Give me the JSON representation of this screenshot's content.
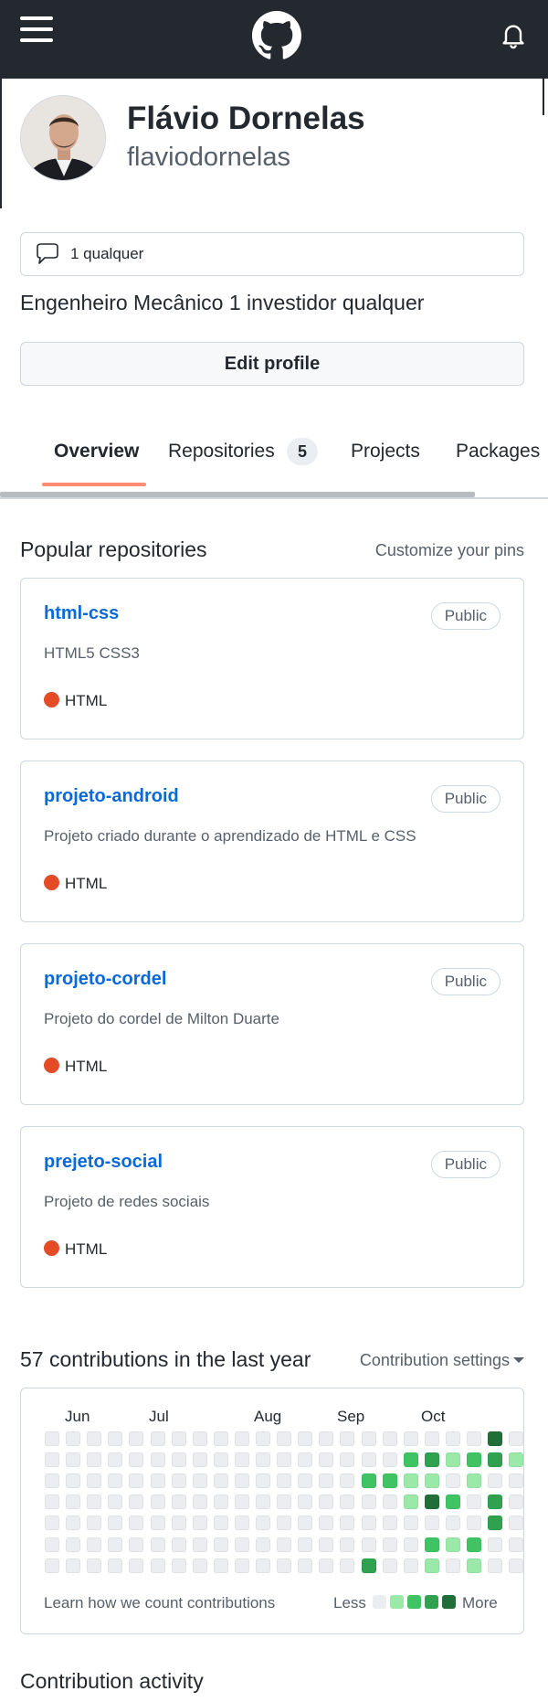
{
  "header": {
    "menu_icon": "hamburger-menu-icon",
    "logo_icon": "github-octocat-icon",
    "notifications_icon": "bell-icon"
  },
  "profile": {
    "name": "Flávio Dornelas",
    "login": "flaviodornelas",
    "status": "1 qualquer",
    "bio": "Engenheiro Mecânico 1 investidor qualquer",
    "edit_label": "Edit profile"
  },
  "tabs": {
    "overview": "Overview",
    "repositories": "Repositories",
    "repositories_count": "5",
    "projects": "Projects",
    "packages": "Packages"
  },
  "popular": {
    "title": "Popular repositories",
    "customize": "Customize your pins",
    "repos": [
      {
        "name": "html-css",
        "visibility": "Public",
        "description": "HTML5 CSS3",
        "language": "HTML"
      },
      {
        "name": "projeto-android",
        "visibility": "Public",
        "description": "Projeto criado durante o aprendizado de HTML e CSS",
        "language": "HTML"
      },
      {
        "name": "projeto-cordel",
        "visibility": "Public",
        "description": "Projeto do cordel de Milton Duarte",
        "language": "HTML"
      },
      {
        "name": "prejeto-social",
        "visibility": "Public",
        "description": "Projeto de redes sociais",
        "language": "HTML"
      }
    ],
    "language_color": "#e34c26"
  },
  "contributions": {
    "title": "57 contributions in the last year",
    "settings": "Contribution settings",
    "months": [
      "Jun",
      "Jul",
      "Aug",
      "Sep",
      "Oct"
    ],
    "learn": "Learn how we count contributions",
    "less": "Less",
    "more": "More",
    "colors": [
      "#ebedf0",
      "#9be9a8",
      "#40c463",
      "#30a14e",
      "#216e39"
    ],
    "levels": [
      [
        0,
        0,
        0,
        0,
        0,
        0,
        0
      ],
      [
        0,
        0,
        0,
        0,
        0,
        0,
        0
      ],
      [
        0,
        0,
        0,
        0,
        0,
        0,
        0
      ],
      [
        0,
        0,
        0,
        0,
        0,
        0,
        0
      ],
      [
        0,
        0,
        0,
        0,
        0,
        0,
        0
      ],
      [
        0,
        0,
        0,
        0,
        0,
        0,
        0
      ],
      [
        0,
        0,
        0,
        0,
        0,
        0,
        0
      ],
      [
        0,
        0,
        0,
        0,
        0,
        0,
        0
      ],
      [
        0,
        0,
        0,
        0,
        0,
        0,
        0
      ],
      [
        0,
        0,
        0,
        0,
        0,
        0,
        0
      ],
      [
        0,
        0,
        0,
        0,
        0,
        0,
        0
      ],
      [
        0,
        0,
        0,
        0,
        0,
        0,
        0
      ],
      [
        0,
        0,
        0,
        0,
        0,
        0,
        0
      ],
      [
        0,
        0,
        0,
        0,
        0,
        0,
        0
      ],
      [
        0,
        0,
        0,
        0,
        0,
        0,
        0
      ],
      [
        0,
        0,
        2,
        0,
        0,
        0,
        3
      ],
      [
        0,
        0,
        2,
        0,
        0,
        0,
        0
      ],
      [
        0,
        2,
        1,
        1,
        0,
        0,
        0
      ],
      [
        0,
        3,
        1,
        4,
        0,
        2,
        1
      ],
      [
        0,
        1,
        0,
        2,
        0,
        1,
        0
      ],
      [
        0,
        2,
        1,
        0,
        0,
        2,
        1
      ],
      [
        4,
        3,
        0,
        3,
        3,
        0,
        0
      ],
      [
        0,
        1,
        0,
        0,
        0,
        0,
        0
      ]
    ]
  },
  "activity": {
    "title": "Contribution activity"
  }
}
